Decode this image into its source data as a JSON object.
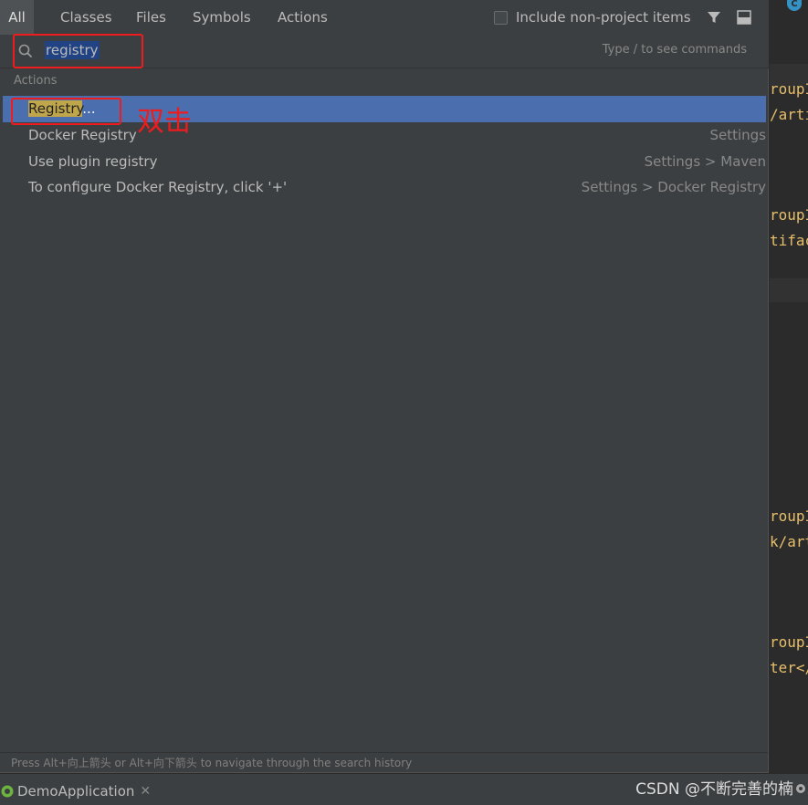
{
  "tabs": [
    {
      "label": "All",
      "active": true
    },
    {
      "label": "Classes",
      "active": false
    },
    {
      "label": "Files",
      "active": false
    },
    {
      "label": "Symbols",
      "active": false
    },
    {
      "label": "Actions",
      "active": false
    }
  ],
  "options": {
    "include_non_project_label": "Include non-project items",
    "include_non_project_checked": false
  },
  "search": {
    "value": "registry",
    "hint": "Type / to see commands"
  },
  "section_title": "Actions",
  "results": [
    {
      "name_match": "Registry",
      "name_rest": "...",
      "location": ""
    },
    {
      "name": "Docker Registry",
      "location": "Settings"
    },
    {
      "name": "Use plugin registry",
      "location": "Settings > Maven"
    },
    {
      "name": "To configure Docker Registry, click '+'",
      "location": "Settings > Docker Registry"
    }
  ],
  "annotation": "双击",
  "footer_hint": "Press Alt+向上箭头 or Alt+向下箭头 to navigate through the search history",
  "editor_fragments": [
    "roupI",
    "/arti",
    "roupI",
    "tifac",
    "roupI",
    "k/art",
    "roupId",
    "ter</"
  ],
  "run_tab_label": "DemoApplication",
  "watermark": "CSDN @不断完善的楠",
  "colors": {
    "selection": "#4b6eaf",
    "match_highlight": "#c0a64b",
    "annotation_red": "#ee1c1c"
  }
}
